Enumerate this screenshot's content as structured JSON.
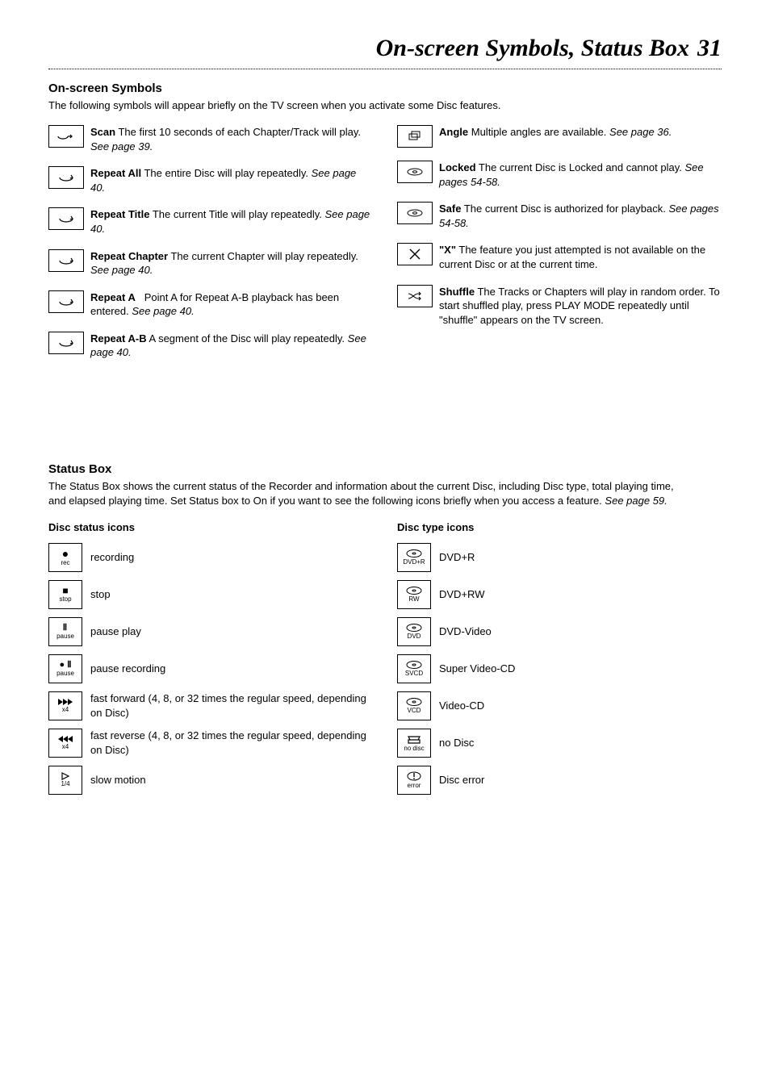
{
  "page": {
    "title": "On-screen Symbols, Status Box",
    "number": "31"
  },
  "symbols": {
    "heading": "On-screen Symbols",
    "intro": "The following symbols will appear briefly on the TV screen when you activate some Disc features.",
    "left": [
      {
        "title": "Scan",
        "body": "The first 10 seconds of each Chapter/Track will play.",
        "ref": "See page 39."
      },
      {
        "title": "Repeat All",
        "body": "The entire Disc will play repeatedly.",
        "ref": "See page 40."
      },
      {
        "title": "Repeat Title",
        "body": "The current Title will play repeatedly.",
        "ref": "See page 40."
      },
      {
        "title": "Repeat Chapter",
        "body": "The current Chapter will play repeatedly.",
        "ref": "See page 40."
      },
      {
        "title": "Repeat A",
        "body": "Point A for Repeat A-B playback has been entered.",
        "ref": "See page 40."
      },
      {
        "title": "Repeat A-B",
        "body": "A segment of the Disc will play repeatedly.",
        "ref": "See page 40."
      }
    ],
    "right": [
      {
        "title": "Angle",
        "body": "Multiple angles are available.",
        "ref": "See page 36."
      },
      {
        "title": "Locked",
        "body": "The current Disc is Locked and cannot play.",
        "ref": "See pages 54-58."
      },
      {
        "title": "Safe",
        "body": "The current Disc is authorized for playback.",
        "ref": "See pages 54-58."
      },
      {
        "title": "\"X\"",
        "body": "The feature you just attempted is not available on the current Disc or at the current time.",
        "ref": ""
      },
      {
        "title": "Shuffle",
        "body": "The Tracks or Chapters will play in random order. To start shuffled play, press PLAY MODE repeatedly until \"shuffle\" appears on the TV screen.",
        "ref": ""
      }
    ]
  },
  "status": {
    "heading": "Status Box",
    "intro": "The Status Box shows the current status of the Recorder and information about the current Disc, including Disc type, total playing time, and elapsed playing time. Set Status box to On if you want to see the following icons briefly when you access a feature.",
    "introRef": "See page 59.",
    "discStatusHead": "Disc status icons",
    "discTypeHead": "Disc type icons",
    "discStatus": [
      {
        "label": "recording",
        "iconSub": "rec"
      },
      {
        "label": "stop",
        "iconSub": "stop"
      },
      {
        "label": "pause play",
        "iconSub": "pause"
      },
      {
        "label": "pause recording",
        "iconSub": "pause"
      },
      {
        "label": "fast forward (4, 8, or 32 times the regular speed, depending on Disc)",
        "iconSub": "x4"
      },
      {
        "label": "fast reverse (4, 8, or 32 times the regular speed, depending on Disc)",
        "iconSub": "x4"
      },
      {
        "label": "slow motion",
        "iconSub": "1/4"
      }
    ],
    "discType": [
      {
        "label": "DVD+R",
        "iconSub": "DVD+R"
      },
      {
        "label": "DVD+RW",
        "iconSub": "RW"
      },
      {
        "label": "DVD-Video",
        "iconSub": "DVD"
      },
      {
        "label": "Super Video-CD",
        "iconSub": "SVCD"
      },
      {
        "label": "Video-CD",
        "iconSub": "VCD"
      },
      {
        "label": "no Disc",
        "iconSub": "no disc"
      },
      {
        "label": "Disc error",
        "iconSub": "error"
      }
    ]
  }
}
